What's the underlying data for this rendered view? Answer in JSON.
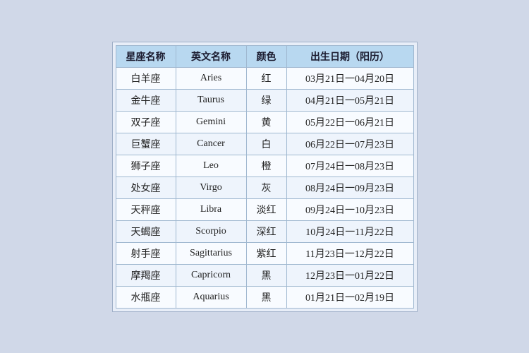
{
  "table": {
    "headers": [
      "星座名称",
      "英文名称",
      "颜色",
      "出生日期（阳历）"
    ],
    "rows": [
      {
        "chinese": "白羊座",
        "english": "Aries",
        "color": "红",
        "date": "03月21日一04月20日"
      },
      {
        "chinese": "金牛座",
        "english": "Taurus",
        "color": "绿",
        "date": "04月21日一05月21日"
      },
      {
        "chinese": "双子座",
        "english": "Gemini",
        "color": "黄",
        "date": "05月22日一06月21日"
      },
      {
        "chinese": "巨蟹座",
        "english": "Cancer",
        "color": "白",
        "date": "06月22日一07月23日"
      },
      {
        "chinese": "狮子座",
        "english": "Leo",
        "color": "橙",
        "date": "07月24日一08月23日"
      },
      {
        "chinese": "处女座",
        "english": "Virgo",
        "color": "灰",
        "date": "08月24日一09月23日"
      },
      {
        "chinese": "天秤座",
        "english": "Libra",
        "color": "淡红",
        "date": "09月24日一10月23日"
      },
      {
        "chinese": "天蝎座",
        "english": "Scorpio",
        "color": "深红",
        "date": "10月24日一11月22日"
      },
      {
        "chinese": "射手座",
        "english": "Sagittarius",
        "color": "紫红",
        "date": "11月23日一12月22日"
      },
      {
        "chinese": "摩羯座",
        "english": "Capricorn",
        "color": "黑",
        "date": "12月23日一01月22日"
      },
      {
        "chinese": "水瓶座",
        "english": "Aquarius",
        "color": "黑",
        "date": "01月21日一02月19日"
      }
    ]
  }
}
